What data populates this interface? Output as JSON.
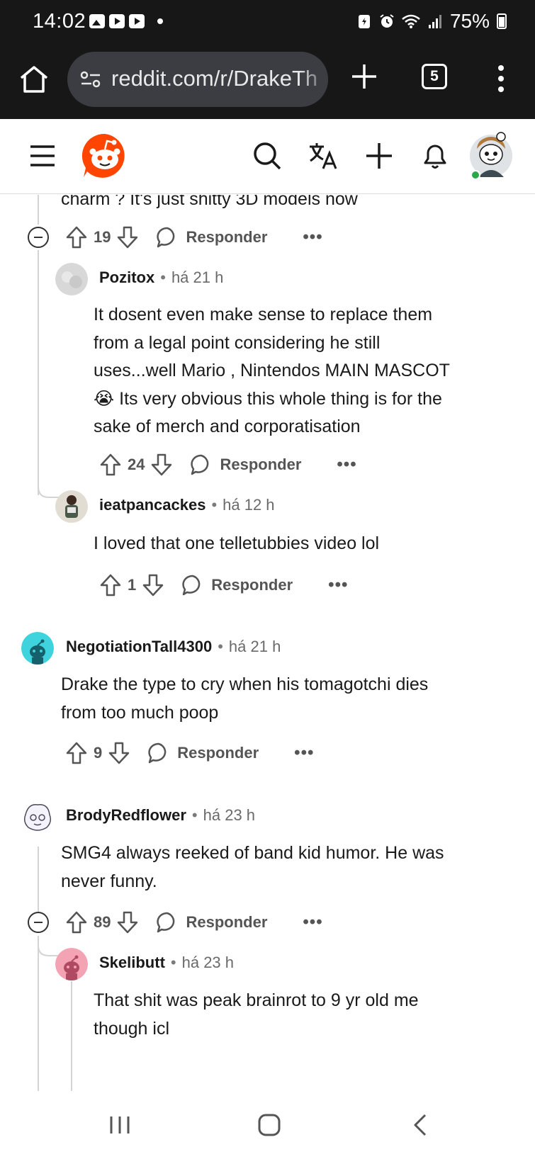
{
  "status_bar": {
    "time": "14:02",
    "battery": "75%"
  },
  "browser": {
    "url": "reddit.com/r/DrakeTh",
    "tab_count": "5"
  },
  "comments": [
    {
      "id": "c0",
      "text": "charm ? It's just shitty 3D models now",
      "upvotes": "19",
      "reply_label": "Responder"
    },
    {
      "id": "c1",
      "user": "Pozitox",
      "sep": "•",
      "time": "há 21 h",
      "lines": [
        "It dosent even make sense to replace them",
        "from a legal point considering he still",
        "uses...well Mario , Nintendos MAIN MASCOT",
        "😭 Its very obvious this whole thing is for the",
        "sake of merch and corporatisation"
      ],
      "upvotes": "24",
      "reply_label": "Responder"
    },
    {
      "id": "c2",
      "user": "ieatpancackes",
      "sep": "•",
      "time": "há 12 h",
      "lines": [
        "I loved that one telletubbies video lol"
      ],
      "upvotes": "1",
      "reply_label": "Responder"
    },
    {
      "id": "c3",
      "user": "NegotiationTall4300",
      "sep": "•",
      "time": "há 21 h",
      "lines": [
        "Drake the type to cry when his tomagotchi dies",
        "from too much poop"
      ],
      "upvotes": "9",
      "reply_label": "Responder"
    },
    {
      "id": "c4",
      "user": "BrodyRedflower",
      "sep": "•",
      "time": "há 23 h",
      "lines": [
        "SMG4 always reeked of band kid humor. He was",
        "never funny."
      ],
      "upvotes": "89",
      "reply_label": "Responder"
    },
    {
      "id": "c5",
      "user": "Skelibutt",
      "sep": "•",
      "time": "há 23 h",
      "lines": [
        "That shit was peak brainrot to 9 yr old me",
        "though icl"
      ]
    }
  ],
  "more_glyph": "•••",
  "colors": {
    "reddit_orange": "#ff4500",
    "status_bg": "#171717",
    "online_green": "#2aa84a"
  }
}
